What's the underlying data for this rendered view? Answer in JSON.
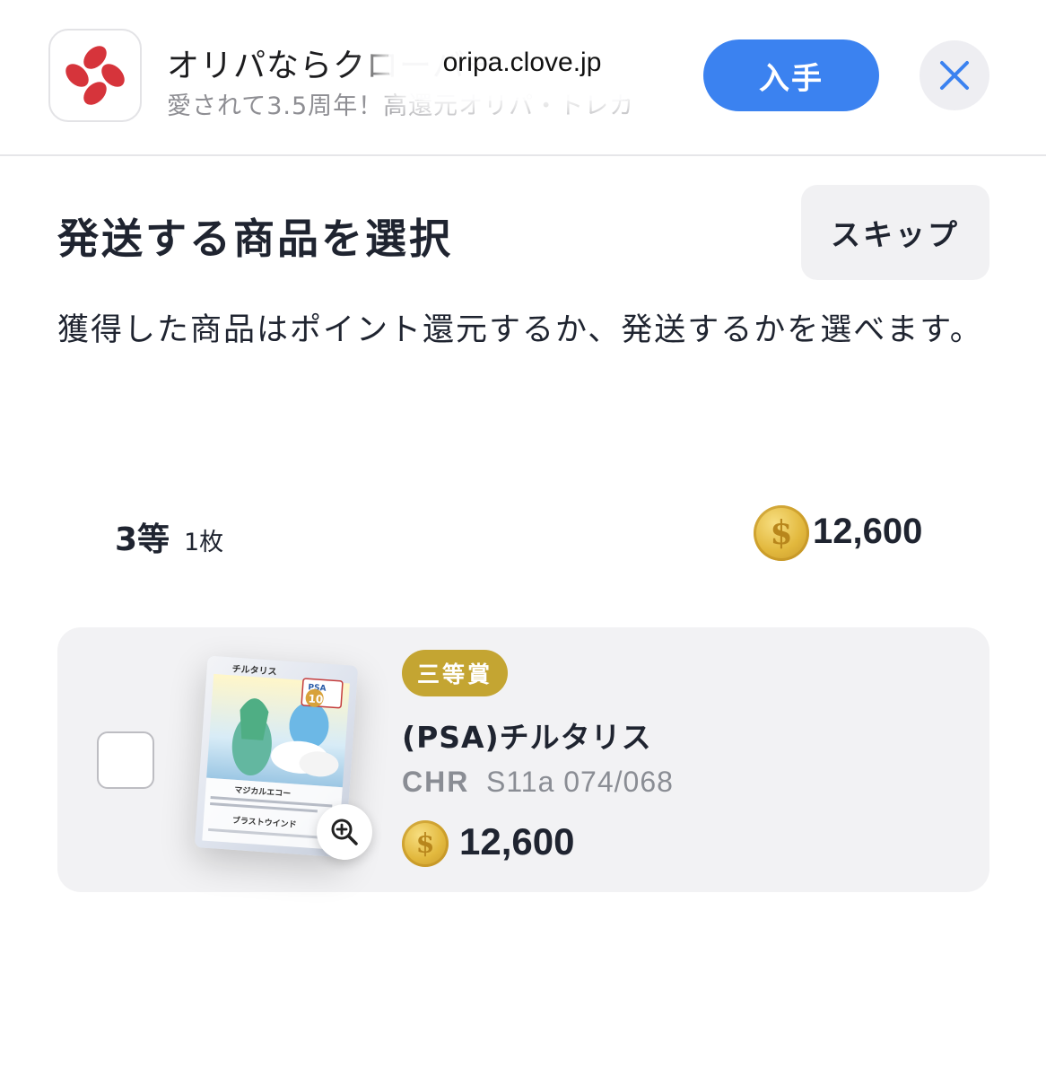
{
  "banner": {
    "app_title": "オリパならクローバー",
    "app_subtitle": "愛されて3.5周年！高還元オリパ・トレカ",
    "url": "oripa.clove.jp",
    "get_label": "入手",
    "close_icon": "close-icon",
    "app_icon": "clover-logo-icon",
    "brand_color": "#d6343b",
    "accent_color": "#3b82f0"
  },
  "header": {
    "title": "発送する商品を選択",
    "skip_label": "スキップ"
  },
  "description": "獲得した商品はポイント還元するか、発送するかを選べます。",
  "group": {
    "rank": "3等",
    "count": "1枚",
    "coin_icon": "coin-icon",
    "points": "12,600"
  },
  "item": {
    "badge": "三等賞",
    "badge_color": "#c4a532",
    "name": "(PSA)チルタリス",
    "rarity": "CHR",
    "code": "S11a 074/068",
    "points": "12,600",
    "checked": false,
    "zoom_icon": "zoom-in-icon",
    "card_image_text": {
      "card_name": "チルタリス",
      "grade_label": "PSA",
      "grade": "10",
      "ability": "マジカルエコー",
      "attack": "ブラストウインド"
    }
  }
}
